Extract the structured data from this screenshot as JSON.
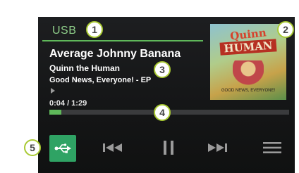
{
  "source": {
    "label": "USB"
  },
  "track": {
    "title": "Average Johnny Banana",
    "artist": "Quinn the Human",
    "album": "Good News, Everyone! - EP",
    "time": "0:04 / 1:29",
    "progress": 0.05
  },
  "album_art": {
    "title_line1": "Quinn",
    "title_line2": "HUMAN",
    "caption": "GOOD NEWS, EVERYONE!"
  },
  "controls": {
    "source_icon": "usb-icon",
    "previous_icon": "previous-track-icon",
    "pause_icon": "pause-icon",
    "next_icon": "next-track-icon",
    "menu_icon": "menu-icon"
  },
  "callouts": [
    "1",
    "2",
    "3",
    "4",
    "5"
  ],
  "colors": {
    "accent": "#5fb85a",
    "usb_button": "#2fa364",
    "callout_ring": "#a8c932"
  }
}
